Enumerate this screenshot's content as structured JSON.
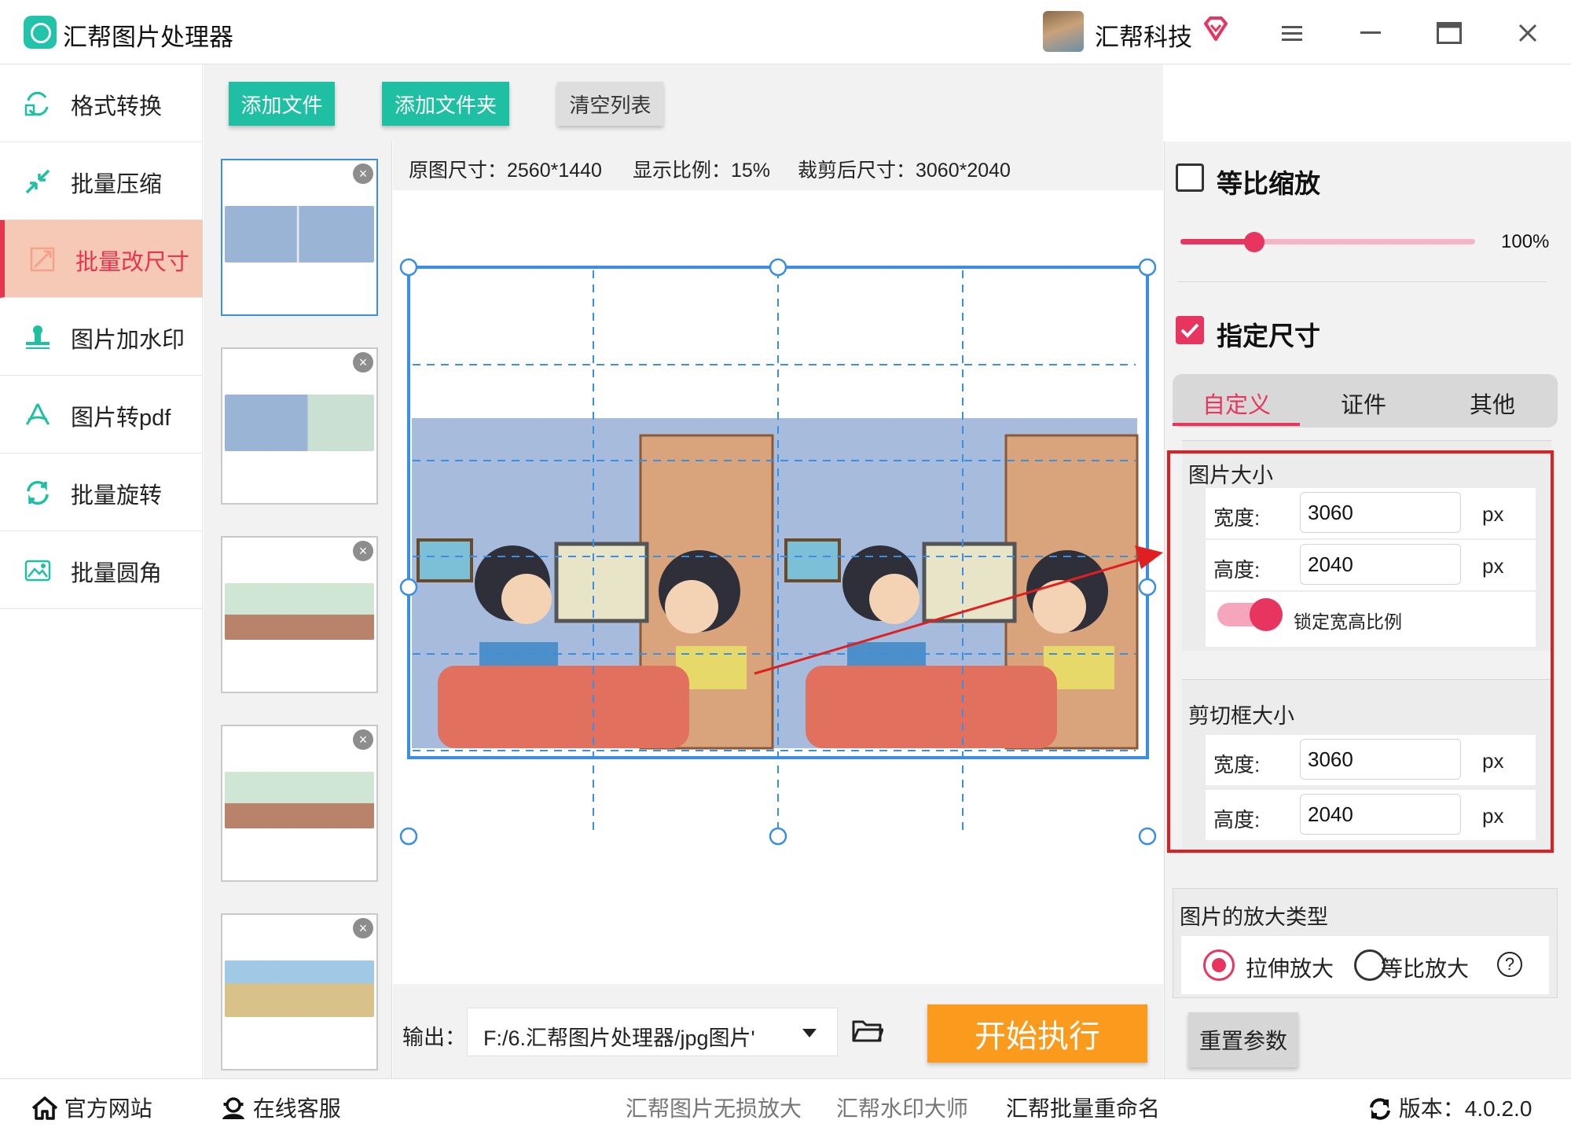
{
  "app": {
    "title": "汇帮图片处理器"
  },
  "user": {
    "name": "汇帮科技"
  },
  "colors": {
    "accent": "#e8355f",
    "teal": "#1fbfa3",
    "orange": "#fb9b1d",
    "highlight": "#e02020"
  },
  "sidebar": {
    "items": [
      {
        "label": "格式转换",
        "icon": "convert-icon",
        "active": false
      },
      {
        "label": "批量压缩",
        "icon": "compress-icon",
        "active": false
      },
      {
        "label": "批量改尺寸",
        "icon": "resize-icon",
        "active": true
      },
      {
        "label": "图片加水印",
        "icon": "watermark-icon",
        "active": false
      },
      {
        "label": "图片转pdf",
        "icon": "pdf-icon",
        "active": false
      },
      {
        "label": "批量旋转",
        "icon": "rotate-icon",
        "active": false
      },
      {
        "label": "批量圆角",
        "icon": "round-corner-icon",
        "active": false
      }
    ]
  },
  "toolbar": {
    "add_file": "添加文件",
    "add_folder": "添加文件夹",
    "clear_list": "清空列表"
  },
  "preview": {
    "original_size": "原图尺寸：2560*1440",
    "display_ratio": "显示比例：15%",
    "cropped_size": "裁剪后尺寸：3060*2040"
  },
  "output": {
    "label": "输出：",
    "path": "F:/6.汇帮图片处理器/jpg图片'",
    "start": "开始执行"
  },
  "panel": {
    "proportional_scale": {
      "label": "等比缩放",
      "checked": false,
      "value": "100%",
      "percent": 25
    },
    "specified_size": {
      "label": "指定尺寸",
      "checked": true
    },
    "tabs": [
      {
        "label": "自定义",
        "active": true
      },
      {
        "label": "证件",
        "active": false
      },
      {
        "label": "其他",
        "active": false
      }
    ],
    "image_size": {
      "title": "图片大小",
      "width_label": "宽度:",
      "width": "3060",
      "height_label": "高度:",
      "height": "2040",
      "unit": "px"
    },
    "lock_ratio": {
      "label": "锁定宽高比例",
      "on": true
    },
    "crop_size": {
      "title": "剪切框大小",
      "width_label": "宽度:",
      "width": "3060",
      "height_label": "高度:",
      "height": "2040",
      "unit": "px"
    },
    "enlarge_type": {
      "title": "图片的放大类型",
      "options": [
        {
          "label": "拉伸放大",
          "selected": true
        },
        {
          "label": "等比放大",
          "selected": false
        }
      ]
    },
    "reset": "重置参数"
  },
  "footer": {
    "website": "官方网站",
    "support": "在线客服",
    "links": [
      "汇帮图片无损放大",
      "汇帮水印大师",
      "汇帮批量重命名"
    ],
    "version": "版本：4.0.2.0"
  }
}
